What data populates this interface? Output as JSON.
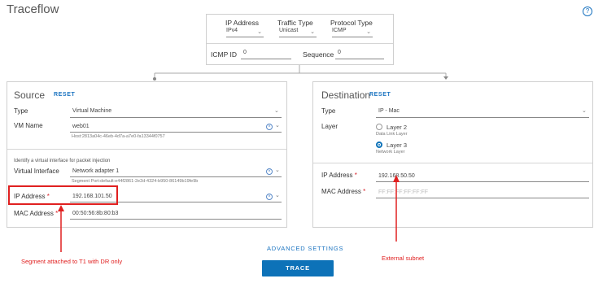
{
  "page": {
    "title": "Traceflow",
    "help_glyph": "?"
  },
  "top": {
    "ip_address": {
      "label": "IP Address",
      "value": "IPv4"
    },
    "traffic_type": {
      "label": "Traffic Type",
      "value": "Unicast"
    },
    "protocol_type": {
      "label": "Protocol Type",
      "value": "ICMP"
    },
    "icmp_id": {
      "label": "ICMP ID",
      "value": "0"
    },
    "sequence": {
      "label": "Sequence",
      "value": "0"
    }
  },
  "source": {
    "title": "Source",
    "reset": "RESET",
    "type": {
      "label": "Type",
      "value": "Virtual Machine"
    },
    "vm_name": {
      "label": "VM Name",
      "value": "web01",
      "host": "Host:2813a04c-46eb-4d7a-a7e0-fa13344f0757"
    },
    "vif_note": "Identify a virtual interface for packet injection",
    "virtual_interface": {
      "label": "Virtual Interface",
      "value": "Network adapter 1",
      "segment_port": "Segment Port:default:e44f2861-2e2d-4324-b950-86149b19fe9b"
    },
    "ip_address": {
      "label": "IP Address",
      "required": "*",
      "value": "192.168.101.50"
    },
    "mac_address": {
      "label": "MAC Address",
      "required": "*",
      "value": "00:50:56:8b:80:b3"
    }
  },
  "destination": {
    "title": "Destination",
    "reset": "RESET",
    "type": {
      "label": "Type",
      "value": "IP - Mac"
    },
    "layer": {
      "label": "Layer",
      "options": [
        {
          "name": "Layer 2",
          "sub": "Data Link Layer",
          "selected": false
        },
        {
          "name": "Layer 3",
          "sub": "Network Layer",
          "selected": true
        }
      ]
    },
    "ip_address": {
      "label": "IP Address",
      "required": "*",
      "value": "192.168.50.50"
    },
    "mac_address": {
      "label": "MAC Address",
      "required": "*",
      "placeholder": "FF:FF:FF:FF:FF:FF"
    }
  },
  "actions": {
    "advanced": "ADVANCED SETTINGS",
    "trace": "TRACE"
  },
  "annotations": {
    "segment_note": "Segment attached to T1 with DR only",
    "external_note": "External subnet"
  },
  "colors": {
    "accent": "#0d72b8",
    "annotation": "#e02020"
  }
}
